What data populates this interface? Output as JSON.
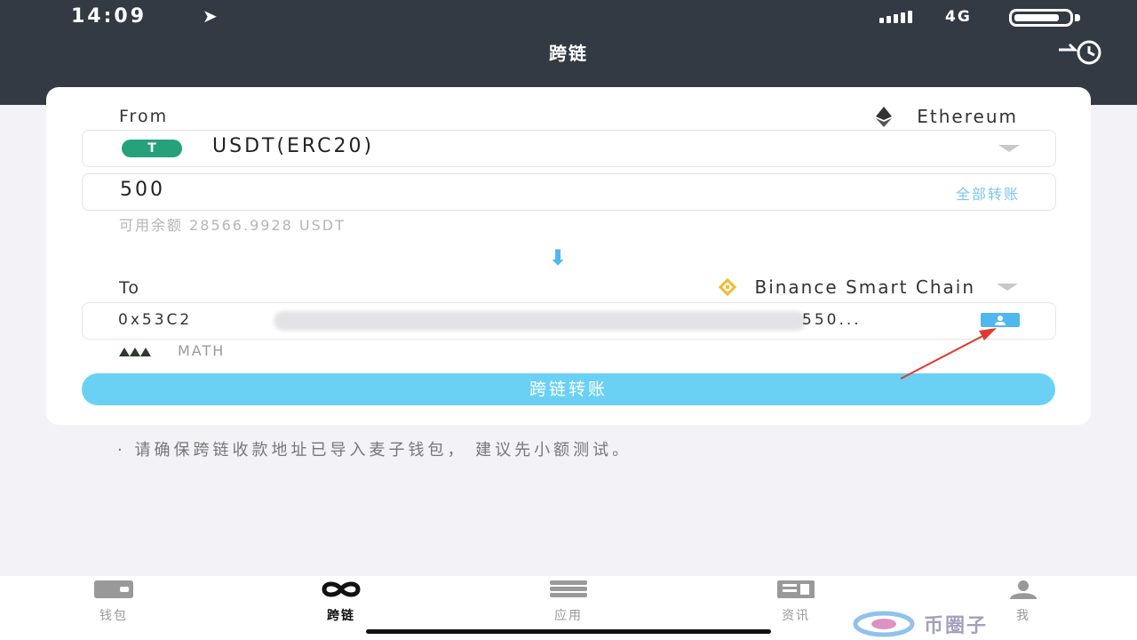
{
  "status_bar": {
    "time": "14:09",
    "network": "4G"
  },
  "header": {
    "title": "跨链"
  },
  "from": {
    "label": "From",
    "chain": "Ethereum",
    "token": "USDT(ERC20)",
    "amount": "500",
    "transfer_all_label": "全部转账",
    "balance_text": "可用余额 28566.9928 USDT"
  },
  "to": {
    "label": "To",
    "chain": "Binance Smart Chain",
    "address_prefix": "0x53C2",
    "address_suffix": "550...",
    "wallet_name": "MATH"
  },
  "submit_label": "跨链转账",
  "notice": "· 请确保跨链收款地址已导入麦子钱包， 建议先小额测试。",
  "tabbar": {
    "items": [
      {
        "label": "钱包",
        "icon": "wallet-icon"
      },
      {
        "label": "跨链",
        "icon": "cross-chain-icon"
      },
      {
        "label": "应用",
        "icon": "apps-icon"
      },
      {
        "label": "资讯",
        "icon": "news-icon"
      },
      {
        "label": "我",
        "icon": "profile-icon"
      }
    ],
    "active": "跨链"
  },
  "colors": {
    "header_bg": "#343a44",
    "accent": "#6ad1f5",
    "link": "#7cc6f2",
    "tether": "#26a17b",
    "annotation_arrow": "#e03a2f"
  }
}
